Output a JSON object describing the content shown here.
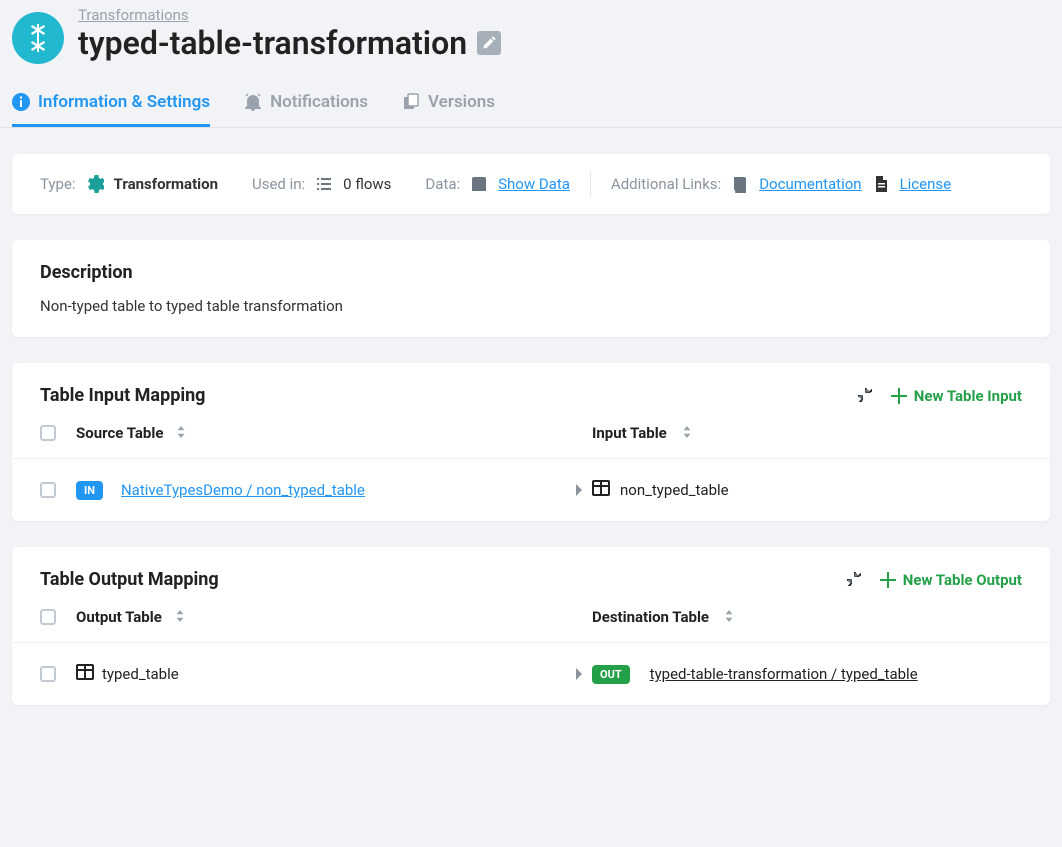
{
  "breadcrumb": {
    "parent": "Transformations"
  },
  "page_title": "typed-table-transformation",
  "tabs": [
    {
      "label": "Information & Settings"
    },
    {
      "label": "Notifications"
    },
    {
      "label": "Versions"
    }
  ],
  "meta": {
    "type_label": "Type:",
    "type_value": "Transformation",
    "used_in_label": "Used in:",
    "used_in_value": "0 flows",
    "data_label": "Data:",
    "show_data": "Show Data",
    "additional_label": "Additional Links:",
    "documentation": "Documentation",
    "license": "License"
  },
  "description": {
    "heading": "Description",
    "text": "Non-typed table to typed table transformation"
  },
  "input_mapping": {
    "heading": "Table Input Mapping",
    "add_label": "New Table Input",
    "col_a": "Source Table",
    "col_b": "Input Table",
    "rows": [
      {
        "badge": "IN",
        "source": "NativeTypesDemo / non_typed_table",
        "target": "non_typed_table"
      }
    ]
  },
  "output_mapping": {
    "heading": "Table Output Mapping",
    "add_label": "New Table Output",
    "col_a": "Output Table",
    "col_b": "Destination Table",
    "rows": [
      {
        "source": "typed_table",
        "badge": "OUT",
        "target": "typed-table-transformation / typed_table"
      }
    ]
  }
}
